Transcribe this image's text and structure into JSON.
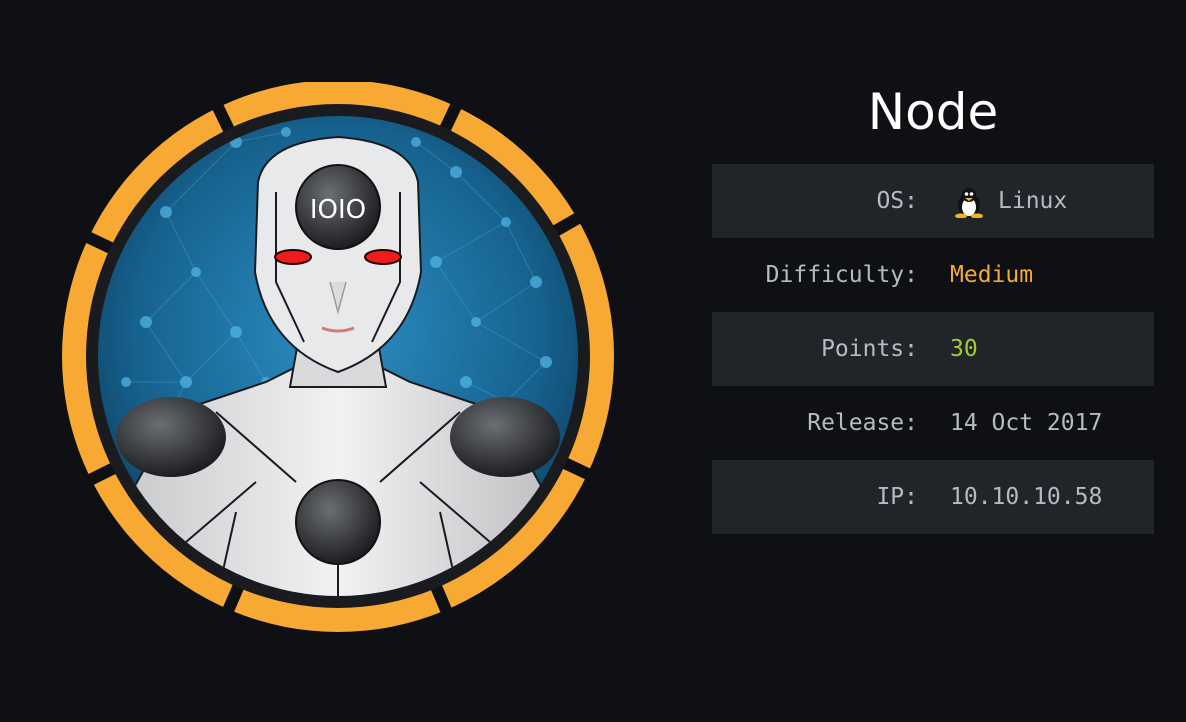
{
  "machine": {
    "name": "Node",
    "avatar_text": "IOIO"
  },
  "info_rows": [
    {
      "label": "OS:",
      "value": "Linux",
      "icon": "tux-penguin-icon"
    },
    {
      "label": "Difficulty:",
      "value": "Medium",
      "color": "#f2a93b"
    },
    {
      "label": "Points:",
      "value": "30",
      "color": "#9fce2d"
    },
    {
      "label": "Release:",
      "value": "14 Oct 2017"
    },
    {
      "label": "IP:",
      "value": "10.10.10.58"
    }
  ],
  "colors": {
    "background": "#0f1013",
    "ring": "#f7a934",
    "row_shade": "#212429",
    "text": "#b7bac0",
    "medium": "#f2a93b",
    "points": "#9fce2d"
  }
}
